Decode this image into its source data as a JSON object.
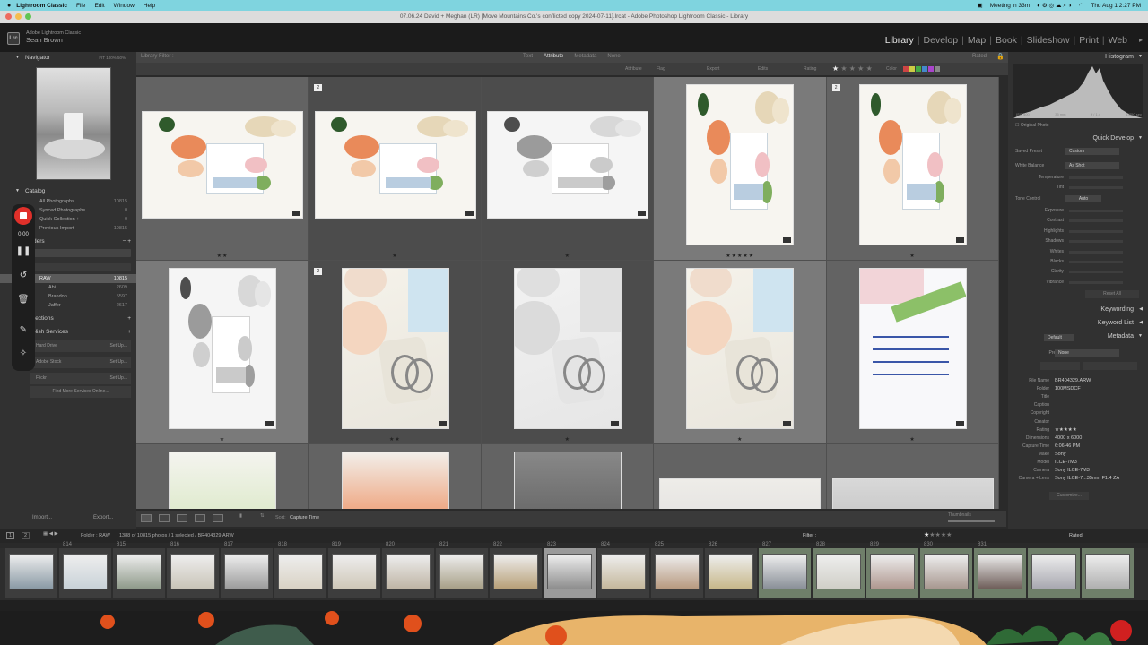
{
  "menubar": {
    "app": "Lightroom Classic",
    "items": [
      "File",
      "Edit",
      "Window",
      "Help"
    ],
    "meeting": "Meeting in 33m",
    "clock": "Thu Aug 1  2:27 PM"
  },
  "window": {
    "title": "07.06.24 David + Meghan (LR) [Move Mountains Co.'s conflicted copy 2024-07-11].lrcat - Adobe Photoshop Lightroom Classic - Library"
  },
  "identity": {
    "product": "Adobe Lightroom Classic",
    "user": "Sean Brown",
    "logo": "Lrc"
  },
  "modules": [
    "Library",
    "Develop",
    "Map",
    "Book",
    "Slideshow",
    "Print",
    "Web"
  ],
  "left_panel": {
    "navigator": "Navigator",
    "nav_zoom": "FIT  100%  50%",
    "catalog": "Catalog",
    "catalog_rows": [
      {
        "label": "All Photographs",
        "count": "10815"
      },
      {
        "label": "Synced Photographs",
        "count": "0"
      },
      {
        "label": "Quick Collection +",
        "count": "0"
      },
      {
        "label": "Previous Import",
        "count": "10815"
      }
    ],
    "folders": "Folders",
    "folder_rows": [
      {
        "label": "RAW",
        "count": "10815"
      },
      {
        "label": "Abi",
        "count": "2609"
      },
      {
        "label": "Brandon",
        "count": "5597"
      },
      {
        "label": "Jaffer",
        "count": "2617"
      }
    ],
    "collections": "Collections",
    "publish": "Publish Services",
    "services": [
      {
        "label": "Hard Drive",
        "action": "Set Up..."
      },
      {
        "label": "Adobe Stock",
        "action": "Set Up..."
      },
      {
        "label": "Flickr",
        "action": "Set Up..."
      }
    ],
    "find_more": "Find More Services Online...",
    "import": "Import...",
    "export": "Export..."
  },
  "recorder": {
    "time": "0:00"
  },
  "center": {
    "filter_title": "Library Filter :",
    "tabs": [
      "Text",
      "Attribute",
      "Metadata",
      "None"
    ],
    "active_tab": "Attribute",
    "rated": "Rated",
    "attr_labels": [
      "Attribute",
      "Flag",
      "Export",
      "Edits",
      "Rating",
      "Color"
    ],
    "sort_label": "Sort:",
    "sort_value": "Capture Time",
    "thumbnails": "Thumbnails"
  },
  "grid": [
    {
      "stars": "★★",
      "badge": "",
      "style": "color",
      "orient": "land",
      "bg": "normal"
    },
    {
      "stars": "★",
      "badge": "2",
      "style": "color",
      "orient": "land",
      "bg": "dark"
    },
    {
      "stars": "★",
      "badge": "",
      "style": "bw",
      "orient": "land",
      "bg": "dark"
    },
    {
      "stars": "★★★★★",
      "badge": "",
      "style": "color",
      "orient": "port",
      "bg": "sel"
    },
    {
      "stars": "★",
      "badge": "2",
      "style": "color",
      "orient": "port",
      "bg": "normal"
    },
    {
      "stars": "★",
      "badge": "",
      "style": "bw",
      "orient": "port",
      "bg": "sel"
    },
    {
      "stars": "★★",
      "badge": "2",
      "style": "ring",
      "orient": "port",
      "bg": "dark"
    },
    {
      "stars": "★",
      "badge": "",
      "style": "ringbw",
      "orient": "port",
      "bg": "dark"
    },
    {
      "stars": "★",
      "badge": "",
      "style": "ring",
      "orient": "port",
      "bg": "sel"
    },
    {
      "stars": "★",
      "badge": "",
      "style": "invite",
      "orient": "port",
      "bg": "normal"
    }
  ],
  "right_panel": {
    "histogram": "Histogram",
    "histo_info": [
      "ISO 400",
      "35 mm",
      "f / 1.4",
      "1/250 sec"
    ],
    "original_photo": "Original Photo",
    "quick_develop": "Quick Develop",
    "saved_preset_label": "Saved Preset",
    "saved_preset": "Custom",
    "white_balance_label": "White Balance",
    "white_balance": "As Shot",
    "wb_rows": [
      "Temperature",
      "Tint"
    ],
    "tone_control_label": "Tone Control",
    "tone_auto": "Auto",
    "tone_rows": [
      "Exposure",
      "Contrast",
      "Highlights",
      "Shadows",
      "Whites",
      "Blacks",
      "Clarity",
      "Vibrance"
    ],
    "reset_all": "Reset All",
    "keywording": "Keywording",
    "keyword_list": "Keyword List",
    "metadata": "Metadata",
    "metadata_preset_select": "Default",
    "preset_label": "Preset",
    "preset_value": "None",
    "meta": [
      {
        "label": "File Name",
        "value": "BR404329.ARW"
      },
      {
        "label": "Folder",
        "value": "100MSDCF"
      },
      {
        "label": "Title",
        "value": ""
      },
      {
        "label": "Caption",
        "value": ""
      },
      {
        "label": "Copyright",
        "value": ""
      },
      {
        "label": "Creator",
        "value": ""
      },
      {
        "label": "Rating",
        "value": "★★★★★"
      },
      {
        "label": "Dimensions",
        "value": "4000 x 6000"
      },
      {
        "label": "Capture Time",
        "value": "6:06:46 PM"
      },
      {
        "label": "Make",
        "value": "Sony"
      },
      {
        "label": "Model",
        "value": "ILCE-7M3"
      },
      {
        "label": "Camera",
        "value": "Sony ILCE-7M3"
      },
      {
        "label": "Camera + Lens",
        "value": "Sony ILCE-7...35mm F1.4 ZA"
      }
    ],
    "customize": "Customize..."
  },
  "filmstrip_bar": {
    "screens": [
      "1",
      "2"
    ],
    "info": "Folder : RAW",
    "count": "1388 of 10815 photos / 1 selected / BR404329.ARW",
    "filter_label": "Filter :",
    "rated": "Rated"
  },
  "filmstrip": [
    {
      "num": "",
      "bg": "normal",
      "img": "#8a9aa5"
    },
    {
      "num": "814",
      "bg": "normal",
      "img": "#c9d2d8"
    },
    {
      "num": "815",
      "bg": "normal",
      "img": "#8f9a8a"
    },
    {
      "num": "816",
      "bg": "normal",
      "img": "#c9c4b8"
    },
    {
      "num": "817",
      "bg": "normal",
      "img": "#9c9c9c"
    },
    {
      "num": "818",
      "bg": "normal",
      "img": "#d9d2c4"
    },
    {
      "num": "819",
      "bg": "normal",
      "img": "#cfc8b8"
    },
    {
      "num": "820",
      "bg": "normal",
      "img": "#bfb5a5"
    },
    {
      "num": "821",
      "bg": "normal",
      "img": "#a8a088"
    },
    {
      "num": "822",
      "bg": "normal",
      "img": "#b8a078"
    },
    {
      "num": "823",
      "bg": "hl",
      "img": "#8e8e8e"
    },
    {
      "num": "824",
      "bg": "normal",
      "img": "#c5b89c"
    },
    {
      "num": "825",
      "bg": "normal",
      "img": "#b89a80"
    },
    {
      "num": "826",
      "bg": "normal",
      "img": "#c8b88a"
    },
    {
      "num": "827",
      "bg": "g",
      "img": "#8a9098"
    },
    {
      "num": "828",
      "bg": "g",
      "img": "#d0cfc8"
    },
    {
      "num": "829",
      "bg": "g",
      "img": "#b09890"
    },
    {
      "num": "830",
      "bg": "g",
      "img": "#a89890"
    },
    {
      "num": "831",
      "bg": "g",
      "img": "#6f5f5a"
    },
    {
      "num": "",
      "bg": "g",
      "img": "#a8a8b0"
    },
    {
      "num": "",
      "bg": "g",
      "img": "#b0b0b0"
    }
  ],
  "colors": {
    "accent_menubar": "#7fd4df",
    "rec_red": "#e0302a",
    "label_colors": [
      "#c44",
      "#cc4",
      "#4a4",
      "#48c",
      "#a4c",
      "#888"
    ]
  }
}
